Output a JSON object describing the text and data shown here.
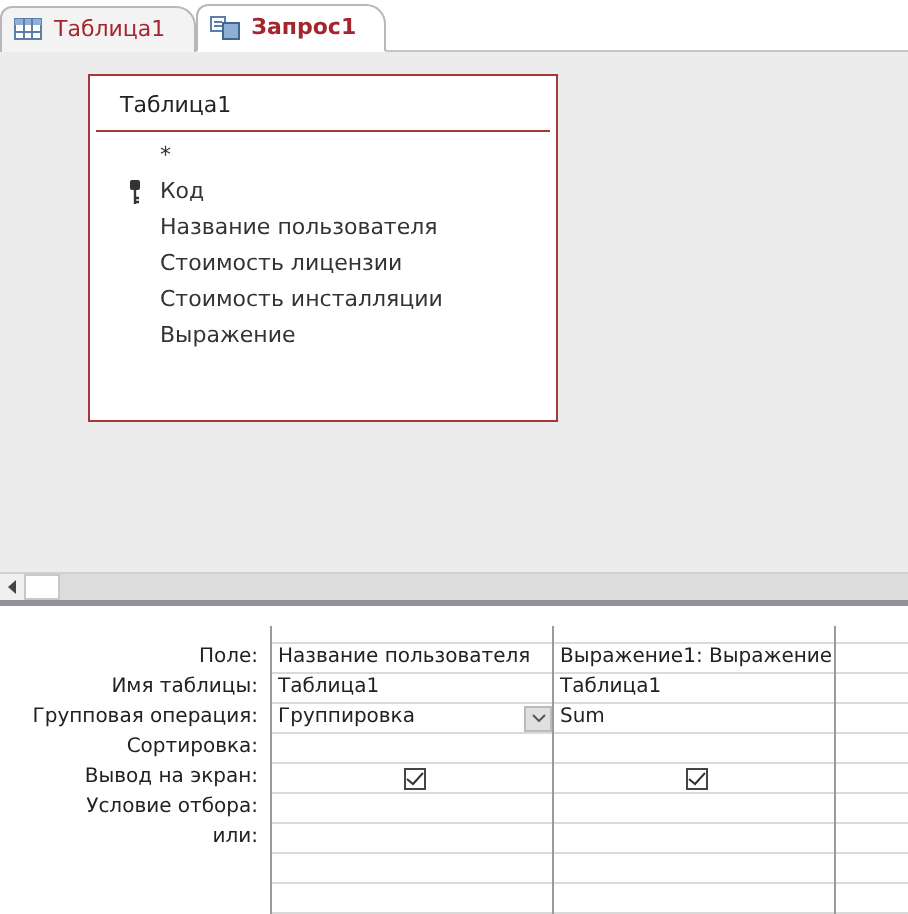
{
  "tabs": [
    {
      "label": "Таблица1",
      "kind": "table",
      "selected": false
    },
    {
      "label": "Запрос1",
      "kind": "query",
      "selected": true
    }
  ],
  "field_list": {
    "title": "Таблица1",
    "fields": [
      {
        "label": "*",
        "primary_key": false
      },
      {
        "label": "Код",
        "primary_key": true
      },
      {
        "label": "Название пользователя",
        "primary_key": false
      },
      {
        "label": "Стоимость лицензии",
        "primary_key": false
      },
      {
        "label": "Стоимость инсталляции",
        "primary_key": false
      },
      {
        "label": "Выражение",
        "primary_key": false
      }
    ]
  },
  "design_grid": {
    "row_labels": [
      "Поле:",
      "Имя таблицы:",
      "Групповая операция:",
      "Сортировка:",
      "Вывод на экран:",
      "Условие отбора:",
      "или:"
    ],
    "columns": [
      {
        "field": "Название пользователя",
        "table": "Таблица1",
        "total": "Группировка",
        "total_dropdown": true,
        "show": true
      },
      {
        "field": "Выражение1: Выражение",
        "table": "Таблица1",
        "total": "Sum",
        "total_dropdown": false,
        "show": true
      }
    ]
  }
}
